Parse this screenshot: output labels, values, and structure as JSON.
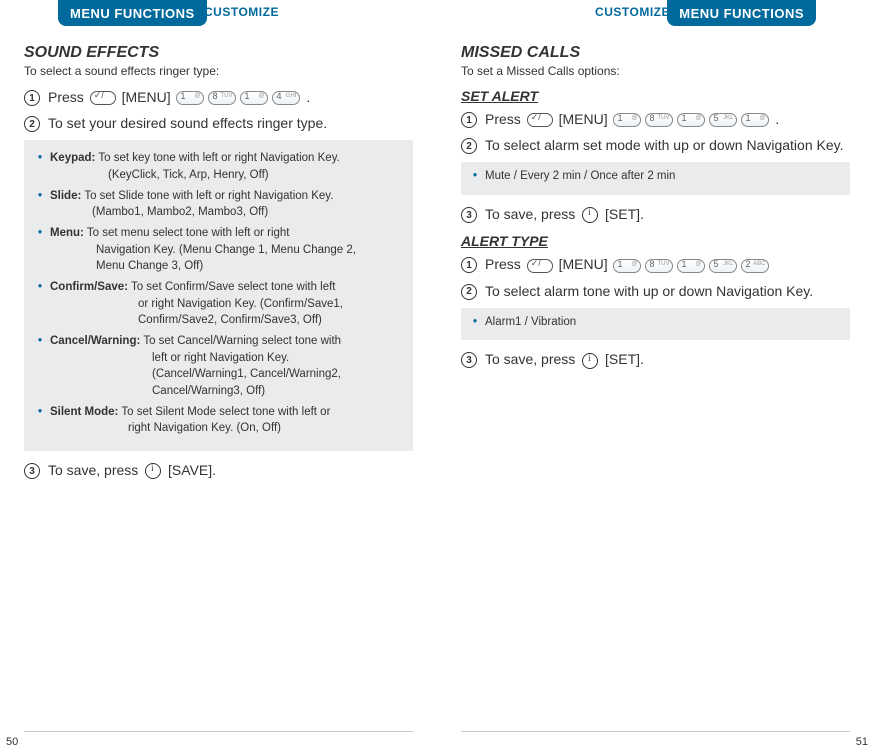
{
  "tabs": {
    "main": "MENU FUNCTIONS",
    "sub": "CUSTOMIZE"
  },
  "left": {
    "heading": "SOUND EFFECTS",
    "sub": "To select a sound effects ringer type:",
    "step1_a": "Press",
    "step1_menu": "[MENU]",
    "step1_end": ".",
    "step1_keys": [
      {
        "n": "1",
        "t": "@"
      },
      {
        "n": "8",
        "t": "TUV"
      },
      {
        "n": "1",
        "t": "@"
      },
      {
        "n": "4",
        "t": "GHI"
      }
    ],
    "step2": "To set your desired sound effects ringer type.",
    "opts": {
      "keypad_k": "Keypad:",
      "keypad_1": "To set key tone with left or right Navigation Key.",
      "keypad_2": "(KeyClick, Tick, Arp, Henry, Off)",
      "slide_k": "Slide:",
      "slide_1": "To set Slide tone with left or right Navigation Key.",
      "slide_2": "(Mambo1, Mambo2, Mambo3, Off)",
      "menu_k": "Menu:",
      "menu_1": "To set menu select tone with left or right",
      "menu_2": "Navigation Key. (Menu Change 1, Menu Change 2,",
      "menu_3": "Menu Change 3, Off)",
      "conf_k": "Confirm/Save:",
      "conf_1": "To set Confirm/Save select tone with left",
      "conf_2": "or right Navigation Key. (Confirm/Save1,",
      "conf_3": "Confirm/Save2, Confirm/Save3, Off)",
      "canc_k": "Cancel/Warning:",
      "canc_1": "To set Cancel/Warning select tone with",
      "canc_2": "left or right Navigation Key.",
      "canc_3": "(Cancel/Warning1, Cancel/Warning2,",
      "canc_4": "Cancel/Warning3, Off)",
      "sil_k": "Silent Mode:",
      "sil_1": "To set Silent Mode select tone with left or",
      "sil_2": "right Navigation Key. (On, Off)"
    },
    "step3_a": "To save, press ",
    "step3_b": "[SAVE].",
    "pnum": "50"
  },
  "right": {
    "heading": "MISSED CALLS",
    "sub": "To set a Missed Calls options:",
    "sect_alert": "SET ALERT",
    "sa_step1_a": "Press",
    "sa_step1_menu": "[MENU]",
    "sa_step1_end": ".",
    "sa_keys": [
      {
        "n": "1",
        "t": "@"
      },
      {
        "n": "8",
        "t": "TUV"
      },
      {
        "n": "1",
        "t": "@"
      },
      {
        "n": "5",
        "t": "JKL"
      },
      {
        "n": "1",
        "t": "@"
      }
    ],
    "sa_step2": "To select alarm set mode with up or down Navigation Key.",
    "sa_opts": "Mute / Every 2 min / Once after 2 min",
    "sa_step3_a": "To save, press ",
    "sa_step3_b": "[SET].",
    "sect_type": "ALERT TYPE",
    "at_step1_a": "Press",
    "at_step1_menu": "[MENU]",
    "at_keys": [
      {
        "n": "1",
        "t": "@"
      },
      {
        "n": "8",
        "t": "TUV"
      },
      {
        "n": "1",
        "t": "@"
      },
      {
        "n": "5",
        "t": "JKL"
      },
      {
        "n": "2",
        "t": "ABC"
      }
    ],
    "at_step2": "To select alarm tone with up or down Navigation Key.",
    "at_opts": "Alarm1 / Vibration",
    "at_step3_a": "To save, press ",
    "at_step3_b": "[SET].",
    "pnum": "51"
  }
}
